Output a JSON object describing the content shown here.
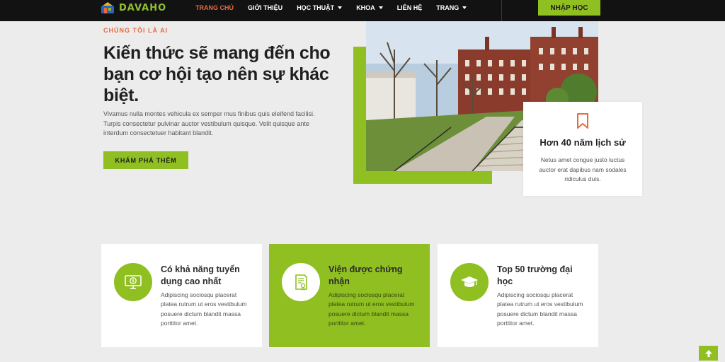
{
  "brand": {
    "name": "DAVAHO",
    "accent": "#8fbf21",
    "highlight": "#e86a40"
  },
  "nav": {
    "items": [
      {
        "label": "TRANG CHỦ",
        "active": true,
        "has_dropdown": false
      },
      {
        "label": "GIỚI THIỆU",
        "active": false,
        "has_dropdown": false
      },
      {
        "label": "HỌC THUẬT",
        "active": false,
        "has_dropdown": true
      },
      {
        "label": "KHOA",
        "active": false,
        "has_dropdown": true
      },
      {
        "label": "LIÊN HỆ",
        "active": false,
        "has_dropdown": false
      },
      {
        "label": "TRANG",
        "active": false,
        "has_dropdown": true
      }
    ],
    "cta_label": "NHẬP HỌC"
  },
  "hero": {
    "eyebrow": "CHÚNG TÔI LÀ AI",
    "title": "Kiến thức sẽ mang đến cho bạn cơ hội tạo nên sự khác biệt.",
    "description": "Vivamus nulla montes vehicula ex semper mus finibus quis eleifend facilisi. Turpis consectetur pulvinar auctor vestibulum quisque. Velit quisque ante interdum consectetuer habitant blandit.",
    "button_label": "KHÁM PHÁ THÊM"
  },
  "info_card": {
    "icon": "bookmark-icon",
    "title": "Hơn 40 năm lịch sử",
    "text": "Netus amet congue justo luctus auctor erat dapibus nam sodales ridiculus duis."
  },
  "features": [
    {
      "icon": "money-monitor-icon",
      "title": "Có khả năng tuyển dụng cao nhất",
      "text": "Adipiscing sociosqu placerat platea rutrum ut eros vestibulum posuere dictum blandit massa porttitor amet.",
      "highlighted": false
    },
    {
      "icon": "certificate-icon",
      "title": "Viện được chứng nhận",
      "text": "Adipiscing sociosqu placerat platea rutrum ut eros vestibulum posuere dictum blandit massa porttitor amet.",
      "highlighted": true
    },
    {
      "icon": "graduation-cap-icon",
      "title": "Top 50 trường đại học",
      "text": "Adipiscing sociosqu placerat platea rutrum ut eros vestibulum posuere dictum blandit massa porttitor amet.",
      "highlighted": false
    }
  ],
  "scroll_top_icon": "arrow-up-icon"
}
